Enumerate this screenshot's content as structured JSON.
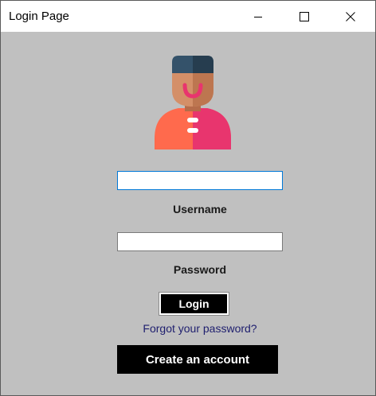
{
  "window": {
    "title": "Login Page"
  },
  "icons": {
    "minimize": "minimize-icon",
    "maximize": "maximize-icon",
    "close": "close-icon",
    "avatar": "user-avatar-icon"
  },
  "form": {
    "username_value": "",
    "username_label": "Username",
    "password_value": "",
    "password_label": "Password",
    "login_label": "Login",
    "forgot_label": "Forgot your password?",
    "create_label": "Create an account"
  },
  "colors": {
    "client_background": "#c0c0c0",
    "button_background": "#000000",
    "button_text": "#ffffff",
    "link": "#1e1e6e",
    "focus_border": "#0078d7",
    "avatar_hat": "#2c4558",
    "avatar_skin": "#c8805a",
    "avatar_body_left": "#ff6a4d",
    "avatar_body_right": "#e8356e"
  }
}
